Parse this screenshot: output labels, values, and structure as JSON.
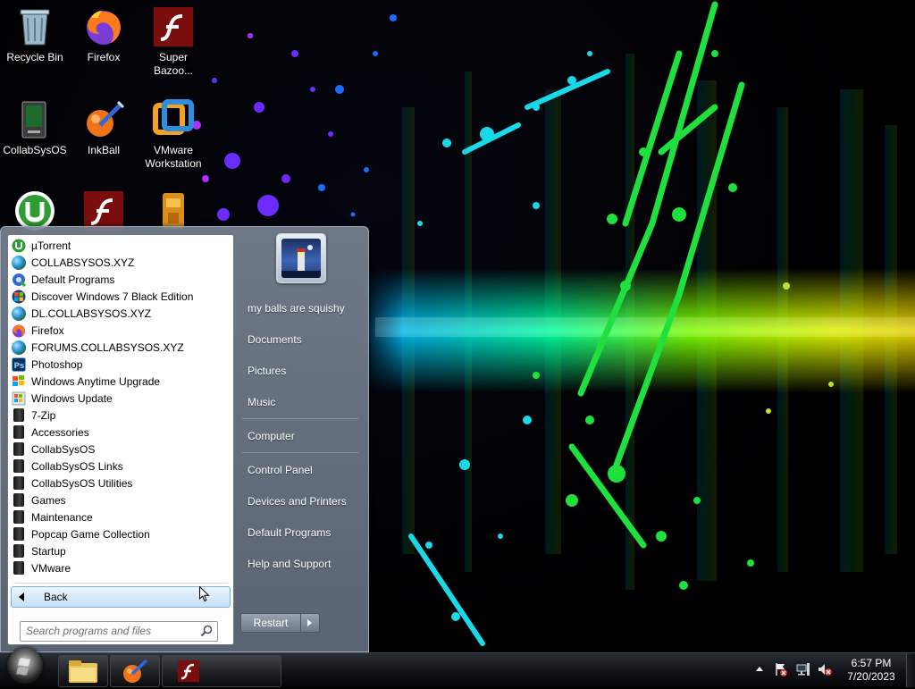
{
  "desktop": {
    "icons": [
      {
        "label": "Recycle Bin",
        "icon": "recycle-bin-icon"
      },
      {
        "label": "Firefox",
        "icon": "firefox-icon"
      },
      {
        "label": "Super Bazoo...",
        "icon": "flash-icon"
      },
      {
        "label": "CollabSysOS",
        "icon": "collabsysos-icon"
      },
      {
        "label": "InkBall",
        "icon": "inkball-icon"
      },
      {
        "label": "VMware Workstation",
        "icon": "vmware-icon"
      },
      {
        "label": "",
        "icon": "utorrent-icon"
      },
      {
        "label": "",
        "icon": "flash-icon"
      },
      {
        "label": "",
        "icon": "game-icon"
      }
    ]
  },
  "start_menu": {
    "programs": [
      {
        "label": "µTorrent",
        "icon": "utorrent-icon"
      },
      {
        "label": "COLLABSYSOS.XYZ",
        "icon": "globe-icon"
      },
      {
        "label": "Default Programs",
        "icon": "default-programs-icon"
      },
      {
        "label": "Discover Windows 7 Black Edition",
        "icon": "windows-logo-icon"
      },
      {
        "label": "DL.COLLABSYSOS.XYZ",
        "icon": "globe-icon"
      },
      {
        "label": "Firefox",
        "icon": "firefox-icon"
      },
      {
        "label": "FORUMS.COLLABSYSOS.XYZ",
        "icon": "globe-icon"
      },
      {
        "label": "Photoshop",
        "icon": "photoshop-icon"
      },
      {
        "label": "Windows Anytime Upgrade",
        "icon": "windows-logo-icon"
      },
      {
        "label": "Windows Update",
        "icon": "windows-update-icon"
      },
      {
        "label": "7-Zip",
        "icon": "folder-icon"
      },
      {
        "label": "Accessories",
        "icon": "folder-icon"
      },
      {
        "label": "CollabSysOS",
        "icon": "folder-icon"
      },
      {
        "label": "CollabSysOS Links",
        "icon": "folder-icon"
      },
      {
        "label": "CollabSysOS Utilities",
        "icon": "folder-icon"
      },
      {
        "label": "Games",
        "icon": "folder-icon"
      },
      {
        "label": "Maintenance",
        "icon": "folder-icon"
      },
      {
        "label": "Popcap Game Collection",
        "icon": "folder-icon"
      },
      {
        "label": "Startup",
        "icon": "folder-icon"
      },
      {
        "label": "VMware",
        "icon": "folder-icon"
      }
    ],
    "back_label": "Back",
    "search_placeholder": "Search programs and files",
    "right_items": [
      "my balls are squishy",
      "Documents",
      "Pictures",
      "Music",
      "Computer",
      "Control Panel",
      "Devices and Printers",
      "Default Programs",
      "Help and Support"
    ],
    "restart_label": "Restart"
  },
  "taskbar": {
    "pinned": [
      {
        "icon": "file-explorer-icon"
      },
      {
        "icon": "inkball-icon"
      },
      {
        "icon": "flash-icon"
      }
    ],
    "tray_icons": [
      "action-center-icon",
      "network-icon",
      "volume-muted-icon"
    ],
    "clock_time": "6:57 PM",
    "clock_date": "7/20/2023"
  },
  "colors": {
    "menu_highlight": "#c5e0f7",
    "menu_glass": "#6e7887"
  }
}
